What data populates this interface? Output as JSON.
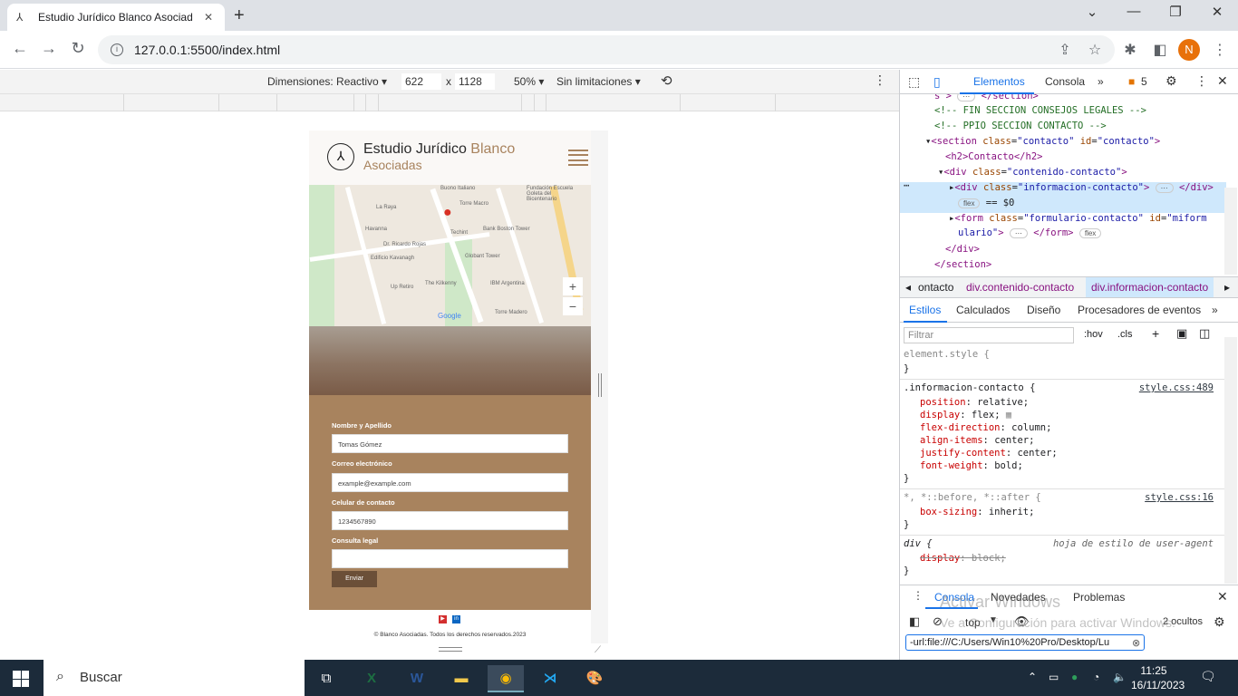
{
  "browser": {
    "tab_title": "Estudio Jurídico Blanco Asociad",
    "tab_favicon": "⅄",
    "url": "127.0.0.1:5500/index.html",
    "profile_initial": "N"
  },
  "device_toolbar": {
    "dimensions": "Dimensiones: Reactivo ▾",
    "width": "622",
    "x": "x",
    "height": "1128",
    "zoom": "50% ▾",
    "throttle": "Sin limitaciones ▾"
  },
  "site": {
    "brand_line1": "Estudio Jurídico",
    "brand_accent": "Blanco",
    "brand_line2": "Asociadas",
    "map_labels": [
      "Buono Italiano",
      "Fundación Escuela Goleta del Bicentenario",
      "La Raya",
      "Torre Macro",
      "Havanna",
      "Techint",
      "Bank Boston Tower",
      "Dr. Ricardo Rojas",
      "Edificio Kavanagh",
      "Globant Tower",
      "Up Retiro",
      "The Kilkenny",
      "IBM Argentina",
      "Torre Madero",
      "Av. Eduardo Madero",
      "Av. del Bajo"
    ],
    "form": {
      "name_label": "Nombre y Apellido",
      "name_value": "Tomas Gómez",
      "email_label": "Correo electrónico",
      "email_placeholder": "example@example.com",
      "phone_label": "Celular de contacto",
      "phone_placeholder": "1234567890",
      "query_label": "Consulta legal",
      "submit_label": "Enviar"
    },
    "copyright": "© Blanco Asociadas. Todos los derechos reservados.2023"
  },
  "devtools": {
    "tabs": [
      "Elementos",
      "Consola",
      "»"
    ],
    "issues_count": "5",
    "dom": [
      "<!-- FIN SECCION CONSEJOS LEGALES -->",
      "<!-- PPIO SECCION CONTACTO -->",
      "<h2>Contacto</h2>"
    ],
    "breadcrumbs": [
      "ontacto",
      "div.contenido-contacto",
      "div.informacion-contacto"
    ],
    "subtabs": [
      "Estilos",
      "Calculados",
      "Diseño",
      "Procesadores de eventos",
      "»"
    ],
    "filter_placeholder": "Filtrar",
    "hov": ":hov",
    "cls": ".cls",
    "rule1_selector": ".informacion-contacto {",
    "rule1_source": "style.css:489",
    "rule2_selector": "*, *::before, *::after {",
    "rule2_source": "style.css:16",
    "rule3_selector": "div {",
    "rule3_source": "hoja de estilo de user-agent",
    "drawer_tabs": [
      "Consola",
      "Novedades",
      "Problemas"
    ],
    "context": "top",
    "hidden": "2 ocultos",
    "filter_url": "-url:file:///C:/Users/Win10%20Pro/Desktop/Lu",
    "watermark1": "Activar Windows",
    "watermark2": "Ve a Configuración para activar Windows."
  },
  "taskbar": {
    "search": "Buscar",
    "time": "11:25",
    "date": "16/11/2023"
  }
}
